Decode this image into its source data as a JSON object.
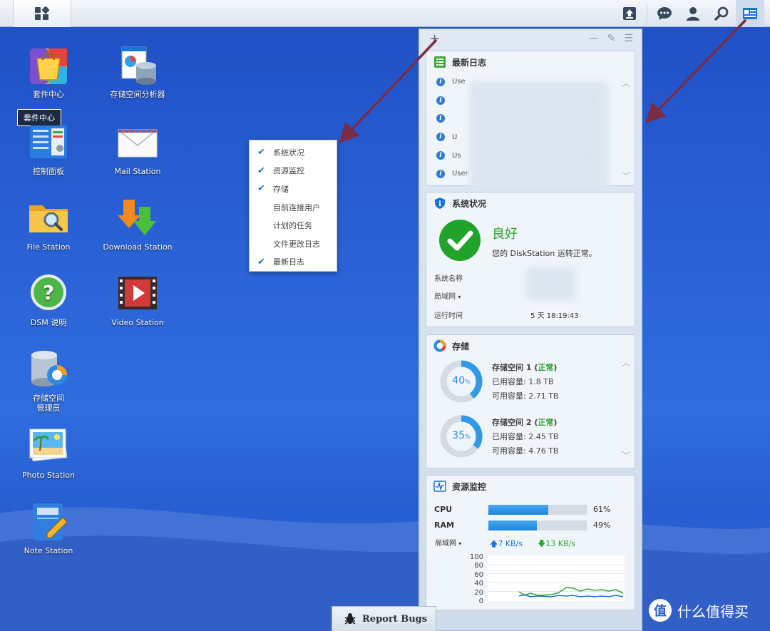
{
  "desktop": {
    "icons": [
      {
        "label": "套件中心"
      },
      {
        "label": "存储空间分析器"
      },
      {
        "label": "控制面板"
      },
      {
        "label": "Mail Station"
      },
      {
        "label": "File Station"
      },
      {
        "label": "Download Station"
      },
      {
        "label": "DSM 说明"
      },
      {
        "label": "Video Station"
      },
      {
        "label": "存储空间\n管理员"
      },
      {
        "label": "Photo Station"
      },
      {
        "label": "Note Station"
      }
    ],
    "tooltip": "套件中心"
  },
  "context_menu": {
    "items": [
      {
        "label": "系统状况",
        "checked": true
      },
      {
        "label": "资源监控",
        "checked": true
      },
      {
        "label": "存储",
        "checked": true
      },
      {
        "label": "目前连接用户",
        "checked": false
      },
      {
        "label": "计划的任务",
        "checked": false
      },
      {
        "label": "文件更改日志",
        "checked": false
      },
      {
        "label": "最新日志",
        "checked": true
      }
    ]
  },
  "widgets": {
    "log": {
      "title": "最新日志",
      "rows": [
        "Use",
        "",
        "",
        "U",
        "Us",
        "User"
      ],
      "row_fragments": [
        "15",
        "",
        "",
        "",
        "2(",
        ""
      ]
    },
    "system": {
      "title": "系统状况",
      "status": "良好",
      "message": "您的 DiskStation 运转正常。",
      "name_label": "系统名称",
      "lan_label": "局域网",
      "uptime_label": "运行时间",
      "uptime_value": "5 天 18:19:43"
    },
    "storage": {
      "title": "存储",
      "volumes": [
        {
          "name": "存储空间 1",
          "status": "正常",
          "used_label": "已用容量: 1.8 TB",
          "free_label": "可用容量: 2.71 TB",
          "percent": "40",
          "percent_value": 40
        },
        {
          "name": "存储空间 2",
          "status": "正常",
          "used_label": "已用容量: 2.45 TB",
          "free_label": "可用容量: 4.76 TB",
          "percent": "35",
          "percent_value": 35
        }
      ],
      "percent_unit": "%"
    },
    "resource": {
      "title": "资源监控",
      "cpu_label": "CPU",
      "cpu_pct": "61%",
      "cpu_value": 61,
      "ram_label": "RAM",
      "ram_pct": "49%",
      "ram_value": 49,
      "lan_label": "局域网",
      "upload": "7 KB/s",
      "download": "13 KB/s",
      "y_ticks": [
        "100",
        "80",
        "60",
        "40",
        "20",
        "0"
      ]
    }
  },
  "taskbar": {
    "report_bugs": "Report Bugs"
  },
  "watermark": "什么值得买",
  "colors": {
    "ok_green": "#2ea32e",
    "accent_blue": "#1a74d8",
    "arrow": "#7a2b45"
  }
}
